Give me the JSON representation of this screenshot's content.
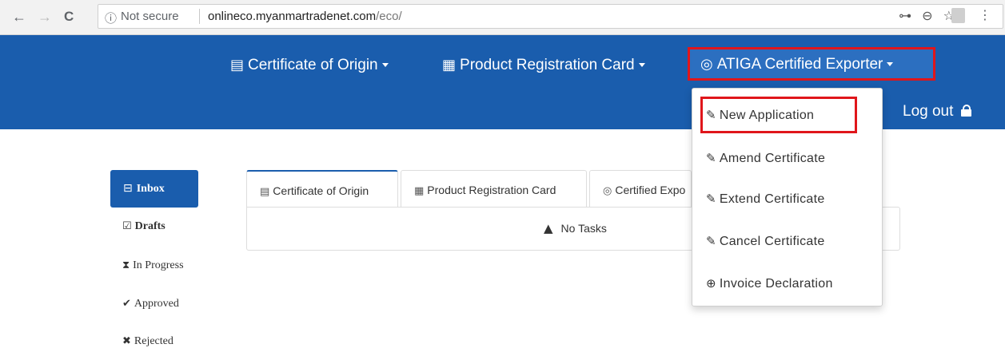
{
  "browser": {
    "back_icon": "←",
    "forward_icon": "→",
    "reload_icon": "C",
    "info_icon": "ⓘ",
    "security_label": "Not secure",
    "url_host": "onlineco.myanmartradenet.com",
    "url_path": "/eco/",
    "key_icon": "⊶",
    "zoom_icon": "⊖",
    "star_icon": "☆",
    "menu_icon": "⋮"
  },
  "navbar": {
    "items": [
      {
        "icon": "▤",
        "label": "Certificate of Origin"
      },
      {
        "icon": "▦",
        "label": "Product Registration Card"
      },
      {
        "icon": "◎",
        "label": "ATIGA Certified Exporter"
      }
    ],
    "logout_label": "Log out",
    "logout_icon": "🔒"
  },
  "dropdown": {
    "items": [
      {
        "icon": "✎",
        "label": "New Application"
      },
      {
        "icon": "✎",
        "label": "Amend Certificate"
      },
      {
        "icon": "✎",
        "label": "Extend Certificate"
      },
      {
        "icon": "✎",
        "label": "Cancel Certificate"
      },
      {
        "icon": "⊕",
        "label": "Invoice Declaration"
      }
    ]
  },
  "sidebar": {
    "items": [
      {
        "icon": "⊟",
        "label": "Inbox"
      },
      {
        "icon": "☑",
        "label": "Drafts"
      },
      {
        "icon": "⧗",
        "label": "In Progress"
      },
      {
        "icon": "✔",
        "label": "Approved"
      },
      {
        "icon": "✖",
        "label": "Rejected"
      }
    ]
  },
  "tabs": [
    {
      "icon": "▤",
      "label": "Certificate of Origin"
    },
    {
      "icon": "▦",
      "label": "Product Registration Card"
    },
    {
      "icon": "◎",
      "label": "Certified Expo"
    }
  ],
  "panel": {
    "warning_icon": "▲",
    "empty_text": "No Tasks"
  },
  "colors": {
    "brand_blue": "#1a5dad",
    "highlight_red": "#e0161b"
  }
}
